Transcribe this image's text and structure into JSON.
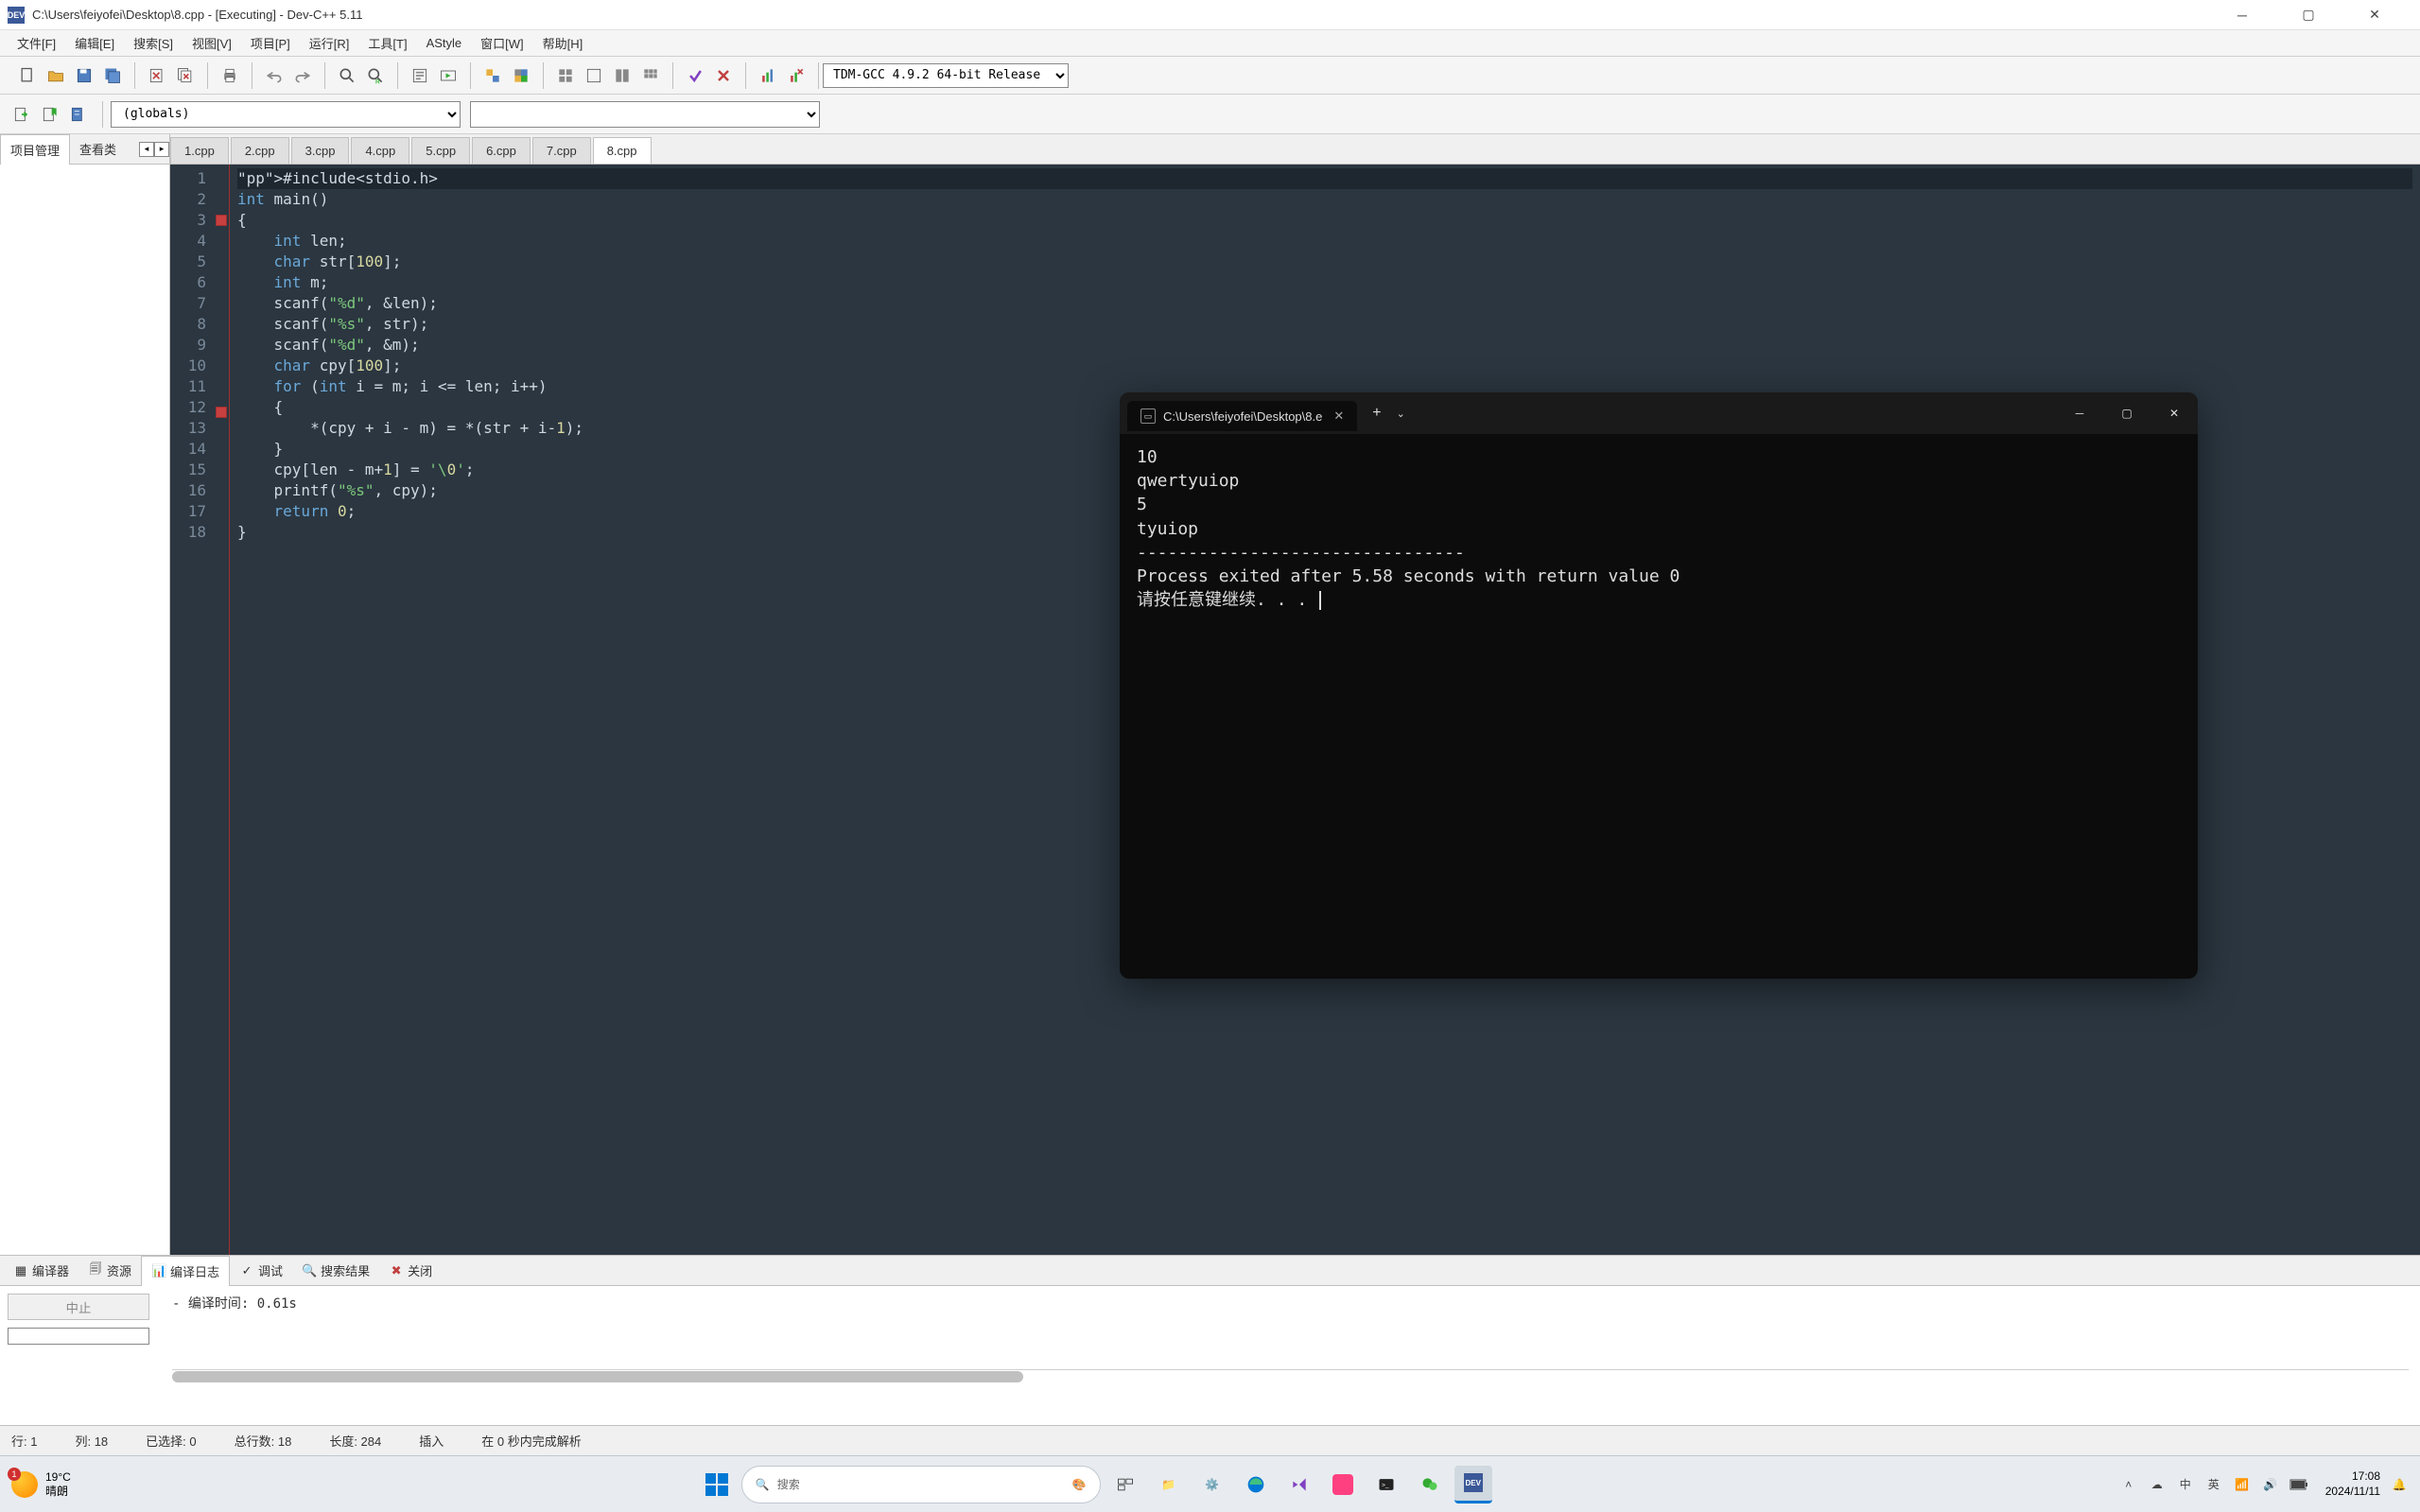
{
  "window": {
    "title": "C:\\Users\\feiyofei\\Desktop\\8.cpp - [Executing] - Dev-C++ 5.11"
  },
  "menu": {
    "file": "文件[F]",
    "edit": "编辑[E]",
    "search": "搜索[S]",
    "view": "视图[V]",
    "project": "项目[P]",
    "run": "运行[R]",
    "tools": "工具[T]",
    "astyle": "AStyle",
    "window": "窗口[W]",
    "help": "帮助[H]"
  },
  "toolbar": {
    "compiler": "TDM-GCC 4.9.2 64-bit Release",
    "scope": "(globals)"
  },
  "left_tabs": {
    "proj": "项目管理",
    "classes": "查看类"
  },
  "tabs": [
    "1.cpp",
    "2.cpp",
    "3.cpp",
    "4.cpp",
    "5.cpp",
    "6.cpp",
    "7.cpp",
    "8.cpp"
  ],
  "active_tab": "8.cpp",
  "code": {
    "lines": [
      "#include<stdio.h>",
      "int main()",
      "{",
      "    int len;",
      "    char str[100];",
      "    int m;",
      "    scanf(\"%d\", &len);",
      "    scanf(\"%s\", str);",
      "    scanf(\"%d\", &m);",
      "    char cpy[100];",
      "    for (int i = m; i <= len; i++)",
      "    {",
      "        *(cpy + i - m) = *(str + i-1);",
      "    }",
      "    cpy[len - m+1] = '\\0';",
      "    printf(\"%s\", cpy);",
      "    return 0;",
      "}"
    ]
  },
  "bottom_tabs": {
    "compiler": "编译器",
    "resource": "资源",
    "compile_log": "编译日志",
    "debug": "调试",
    "search_res": "搜索结果",
    "close": "关闭"
  },
  "bottom": {
    "stop": "中止",
    "output": "- 编译时间: 0.61s"
  },
  "status": {
    "line": "行:  1",
    "col": "列:  18",
    "sel": "已选择:  0",
    "total": "总行数:  18",
    "len": "长度:  284",
    "ins": "插入",
    "parse": "在 0 秒内完成解析"
  },
  "terminal": {
    "tab_title": "C:\\Users\\feiyofei\\Desktop\\8.e",
    "output": "10\nqwertyuiop\n5\ntyuiop\n--------------------------------\nProcess exited after 5.58 seconds with return value 0\n请按任意键继续. . . "
  },
  "taskbar": {
    "temp": "19°C",
    "weather": "晴朗",
    "weather_badge": "1",
    "search_placeholder": "搜索",
    "ime1": "中",
    "ime2": "英",
    "time": "17:08",
    "date": "2024/11/11"
  }
}
